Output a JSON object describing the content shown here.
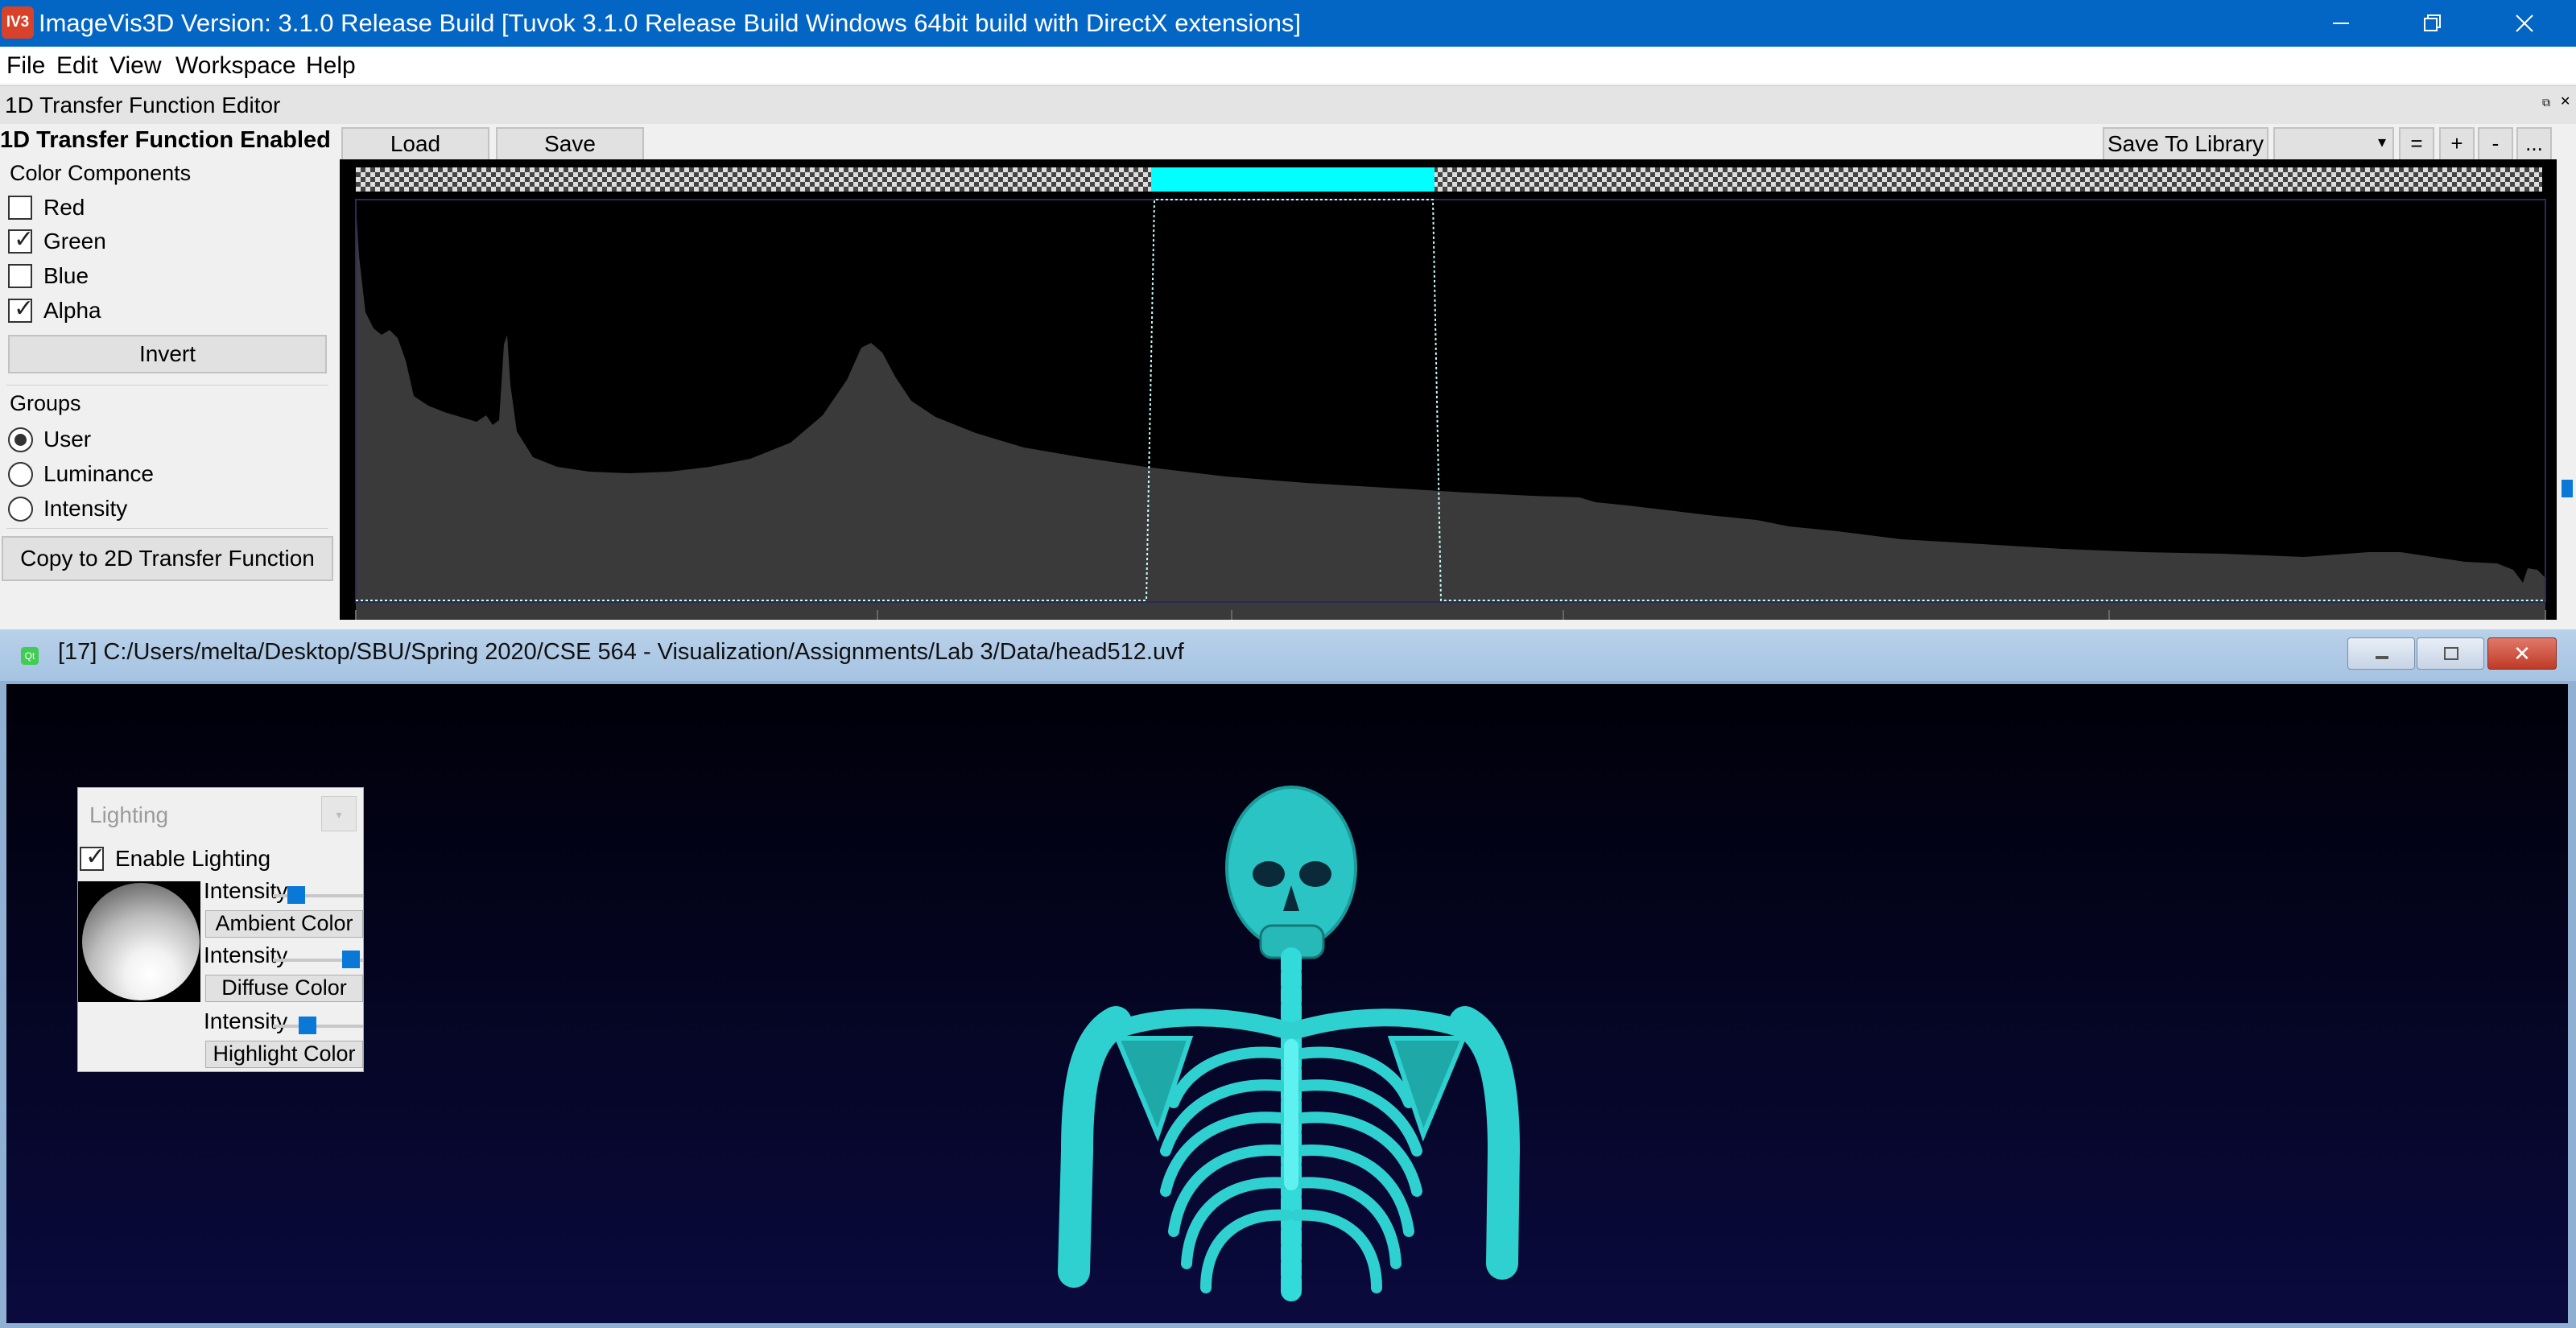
{
  "window": {
    "logo_text": "IV3",
    "title": "ImageVis3D Version: 3.1.0 Release Build [Tuvok 3.1.0 Release Build Windows 64bit build with DirectX extensions]",
    "minimize": "—",
    "restore": "❐",
    "close": "✕"
  },
  "menu": {
    "items": [
      "File",
      "Edit",
      "View",
      "Workspace",
      "Help"
    ]
  },
  "dock": {
    "title": "1D Transfer Function Editor",
    "float_icon": "⧉",
    "close_icon": "✕"
  },
  "tf_editor": {
    "enabled_label": "1D Transfer Function Enabled",
    "load_label": "Load",
    "save_label": "Save",
    "save_library_label": "Save To Library",
    "library_selected": "",
    "library_arrow": "▾",
    "eq_label": "=",
    "plus_label": "+",
    "minus_label": "-",
    "more_label": "...",
    "color_components_label": "Color Components",
    "components": [
      {
        "label": "Red",
        "checked": false
      },
      {
        "label": "Green",
        "checked": true
      },
      {
        "label": "Blue",
        "checked": false
      },
      {
        "label": "Alpha",
        "checked": true
      }
    ],
    "check_mark": "✓",
    "invert_label": "Invert",
    "groups_label": "Groups",
    "groups": [
      {
        "label": "User",
        "selected": true
      },
      {
        "label": "Luminance",
        "selected": false
      },
      {
        "label": "Intensity",
        "selected": false
      }
    ],
    "copy_2d_label": "Copy to 2D Transfer Function",
    "colors": {
      "transfer_color": "#00ffff",
      "histogram_fill": "#3a3a3a",
      "canvas_bg": "#000000"
    }
  },
  "render_window": {
    "app_icon": "Qt",
    "path": "[17] C:/Users/melta/Desktop/SBU/Spring 2020/CSE 564 - Visualization/Assignments/Lab 3/Data/head512.uvf",
    "close_icon": "✕",
    "colors": {
      "bone": "#2fd0d0",
      "background_top": "#000009",
      "background_bottom": "#0a0a3e"
    }
  },
  "lighting": {
    "title": "Lighting",
    "collapse_icon": "▾",
    "enable_label": "Enable Lighting",
    "enabled": true,
    "intensity_label": "Intensity",
    "ambient_label": "Ambient Color",
    "diffuse_label": "Diffuse Color",
    "highlight_label": "Highlight Color",
    "ambient_intensity": 0.2,
    "diffuse_intensity": 0.95,
    "highlight_intensity": 0.35
  }
}
